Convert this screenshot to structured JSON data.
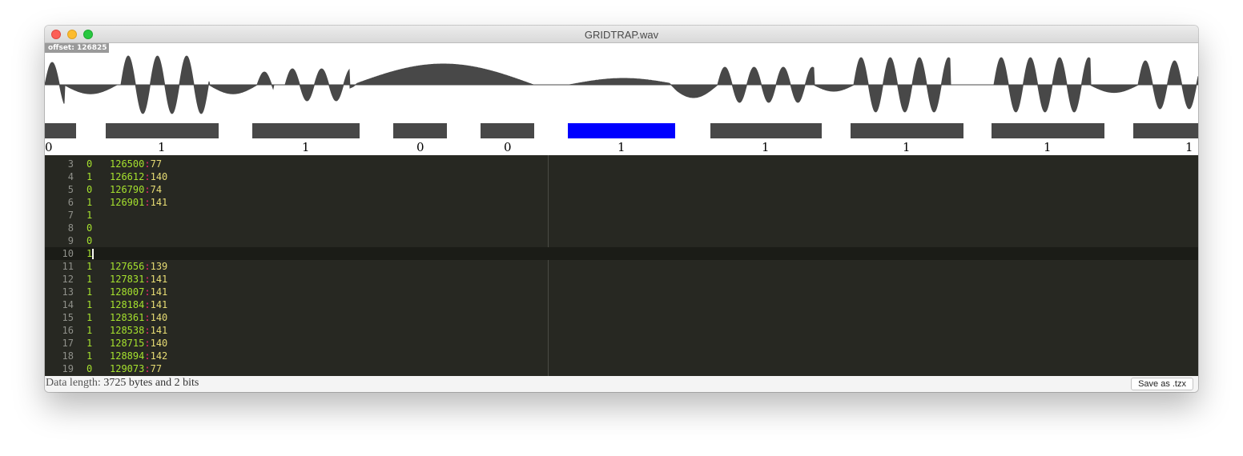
{
  "window": {
    "title": "GRIDTRAP.wav"
  },
  "waveform": {
    "offset_label": "offset: 126825",
    "bits": [
      "0",
      "1",
      "1",
      "0",
      "0",
      "1",
      "1",
      "1",
      "1",
      "1"
    ],
    "selected_pulse_index": 5,
    "colors": {
      "wave": "#484848",
      "pulse": "#484848",
      "selected_pulse": "#0000ff"
    }
  },
  "editor": {
    "lines": [
      {
        "num": "3",
        "bit": "0",
        "offset": "126500",
        "sep": ":",
        "dur": "77"
      },
      {
        "num": "4",
        "bit": "1",
        "offset": "126612",
        "sep": ":",
        "dur": "140"
      },
      {
        "num": "5",
        "bit": "0",
        "offset": "126790",
        "sep": ":",
        "dur": "74"
      },
      {
        "num": "6",
        "bit": "1",
        "offset": "126901",
        "sep": ":",
        "dur": "141"
      },
      {
        "num": "7",
        "bit": "1",
        "offset": "",
        "sep": "",
        "dur": ""
      },
      {
        "num": "8",
        "bit": "0",
        "offset": "",
        "sep": "",
        "dur": ""
      },
      {
        "num": "9",
        "bit": "0",
        "offset": "",
        "sep": "",
        "dur": ""
      },
      {
        "num": "10",
        "bit": "1",
        "offset": "",
        "sep": "",
        "dur": "",
        "current": true
      },
      {
        "num": "11",
        "bit": "1",
        "offset": "127656",
        "sep": ":",
        "dur": "139"
      },
      {
        "num": "12",
        "bit": "1",
        "offset": "127831",
        "sep": ":",
        "dur": "141"
      },
      {
        "num": "13",
        "bit": "1",
        "offset": "128007",
        "sep": ":",
        "dur": "141"
      },
      {
        "num": "14",
        "bit": "1",
        "offset": "128184",
        "sep": ":",
        "dur": "141"
      },
      {
        "num": "15",
        "bit": "1",
        "offset": "128361",
        "sep": ":",
        "dur": "140"
      },
      {
        "num": "16",
        "bit": "1",
        "offset": "128538",
        "sep": ":",
        "dur": "141"
      },
      {
        "num": "17",
        "bit": "1",
        "offset": "128715",
        "sep": ":",
        "dur": "140"
      },
      {
        "num": "18",
        "bit": "1",
        "offset": "128894",
        "sep": ":",
        "dur": "142"
      },
      {
        "num": "19",
        "bit": "0",
        "offset": "129073",
        "sep": ":",
        "dur": "77"
      }
    ],
    "colors": {
      "background": "#272822",
      "line_number": "#8f908a",
      "bit": "#a6e22e",
      "offset": "#a6e22e",
      "separator": "#f92672",
      "duration": "#e6db74"
    }
  },
  "status": {
    "label": "Data length:",
    "value": "3725 bytes and 2 bits",
    "save_button": "Save as .tzx"
  }
}
